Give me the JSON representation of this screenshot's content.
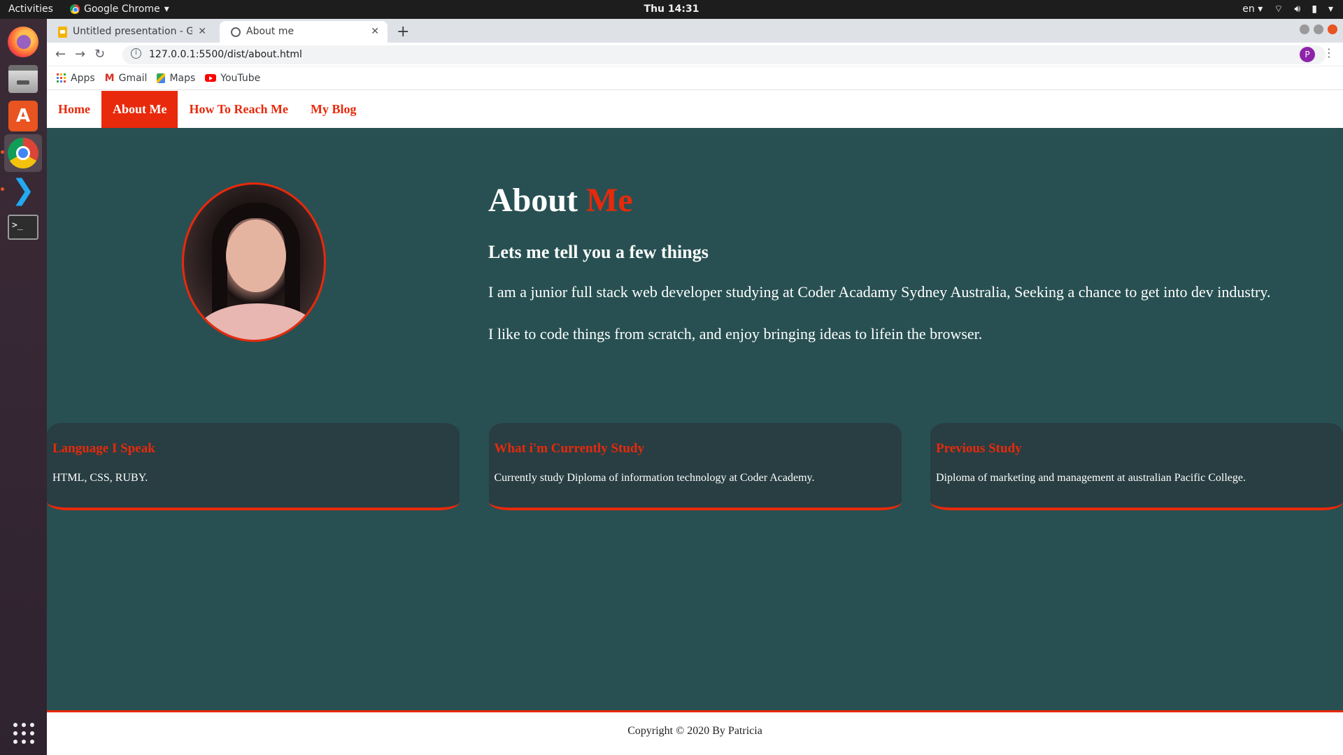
{
  "system_bar": {
    "activities": "Activities",
    "app_name": "Google Chrome",
    "clock": "Thu 14:31",
    "language": "en"
  },
  "browser": {
    "tabs": [
      {
        "title": "Untitled presentation - Go",
        "icon": "slides-icon",
        "active": false
      },
      {
        "title": "About me",
        "icon": "globe-icon",
        "active": true
      }
    ],
    "url": "127.0.0.1:5500/dist/about.html",
    "profile_initial": "P",
    "bookmarks": [
      "Apps",
      "Gmail",
      "Maps",
      "YouTube"
    ]
  },
  "site": {
    "nav": [
      {
        "label": "Home",
        "active": false
      },
      {
        "label": "About Me",
        "active": true
      },
      {
        "label": "How To Reach Me",
        "active": false
      },
      {
        "label": "My Blog",
        "active": false
      }
    ],
    "heading_main": "About",
    "heading_accent": "Me",
    "subtitle": "Lets me tell you a few things",
    "paragraphs": [
      "I am a junior full stack web developer studying at Coder Acadamy Sydney Australia, Seeking a chance to get into dev industry.",
      "I like to code things from scratch, and enjoy bringing ideas to lifein the browser."
    ],
    "cards": [
      {
        "title": "Language I Speak",
        "text": "HTML, CSS, RUBY."
      },
      {
        "title": "What i'm Currently Study",
        "text": "Currently study Diploma of information technology at Coder Academy."
      },
      {
        "title": "Previous Study",
        "text": "Diploma of marketing and management at australian Pacific College."
      }
    ],
    "footer": "Copyright © 2020 By Patricia"
  },
  "colors": {
    "accent": "#e8290b",
    "page_bg": "#285052",
    "card_bg": "#283e42"
  }
}
